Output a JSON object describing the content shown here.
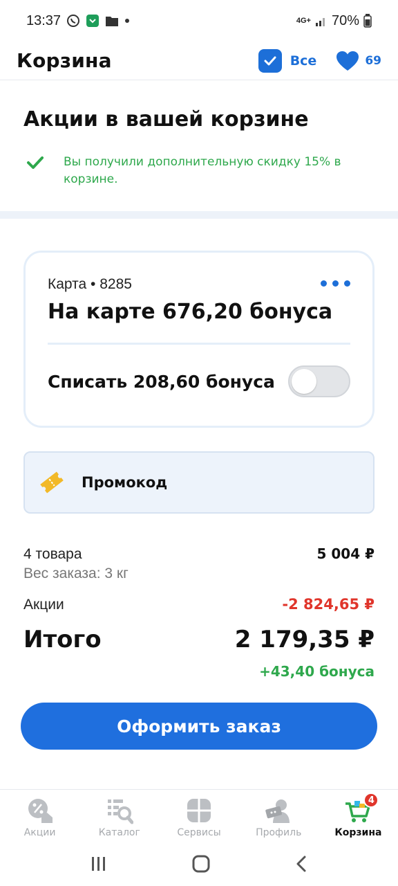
{
  "status": {
    "time": "13:37",
    "network": "4G+",
    "battery": "70%"
  },
  "header": {
    "title": "Корзина",
    "select_all_label": "Все",
    "favorites_count": "69"
  },
  "promo": {
    "title": "Акции в вашей корзине",
    "note": "Вы получили дополнительную скидку 15% в корзине."
  },
  "card": {
    "subtitle": "Карта • 8285",
    "balance": "На карте 676,20 бонуса",
    "writeoff_label": "Списать 208,60 бонуса",
    "writeoff_enabled": false
  },
  "promocode": {
    "label": "Промокод"
  },
  "summary": {
    "items_label": "4 товара",
    "items_price": "5 004 ₽",
    "weight": "Вес заказа: 3 кг",
    "promo_label": "Акции",
    "promo_value": "-2 824,65 ₽",
    "total_label": "Итого",
    "total_value": "2 179,35 ₽",
    "bonus": "+43,40 бонуса"
  },
  "order_button": "Оформить заказ",
  "tabs": [
    {
      "label": "Акции",
      "icon": "percent-icon",
      "active": false
    },
    {
      "label": "Каталог",
      "icon": "catalog-icon",
      "active": false
    },
    {
      "label": "Сервисы",
      "icon": "services-icon",
      "active": false
    },
    {
      "label": "Профиль",
      "icon": "profile-icon",
      "active": false
    },
    {
      "label": "Корзина",
      "icon": "cart-icon",
      "active": true,
      "badge": "4"
    }
  ],
  "colors": {
    "accent": "#1d6fd8",
    "success": "#2ea84c",
    "danger": "#e0352b",
    "promo_yellow": "#f2b928"
  }
}
